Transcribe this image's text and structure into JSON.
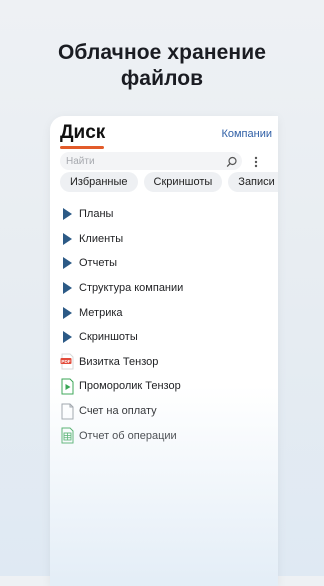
{
  "promo": {
    "title_line1": "Облачное хранение",
    "title_line2": "файлов"
  },
  "app": {
    "title": "Диск",
    "org_link": "Компании",
    "search_placeholder": "Найти"
  },
  "chips": [
    "Избранные",
    "Скриншоты",
    "Записи в"
  ],
  "files": [
    {
      "label": "Планы",
      "icon": "folder-icon"
    },
    {
      "label": "Клиенты",
      "icon": "folder-icon"
    },
    {
      "label": "Отчеты",
      "icon": "folder-icon"
    },
    {
      "label": "Структура компании",
      "icon": "folder-icon"
    },
    {
      "label": "Метрика",
      "icon": "folder-icon"
    },
    {
      "label": "Скриншоты",
      "icon": "folder-icon"
    },
    {
      "label": "Визитка Тензор",
      "icon": "pdf-file-icon",
      "badge": "PDF"
    },
    {
      "label": "Проморолик Тензор",
      "icon": "video-file-icon"
    },
    {
      "label": "Счет на оплату",
      "icon": "document-file-icon"
    },
    {
      "label": "Отчет об операции",
      "icon": "spreadsheet-file-icon"
    }
  ],
  "colors": {
    "accent": "#e25b2a",
    "link": "#2f5fa6",
    "folder": "#2c5a86",
    "pdf": "#e24b3b",
    "video": "#3aa655",
    "spreadsheet": "#3aa655"
  }
}
